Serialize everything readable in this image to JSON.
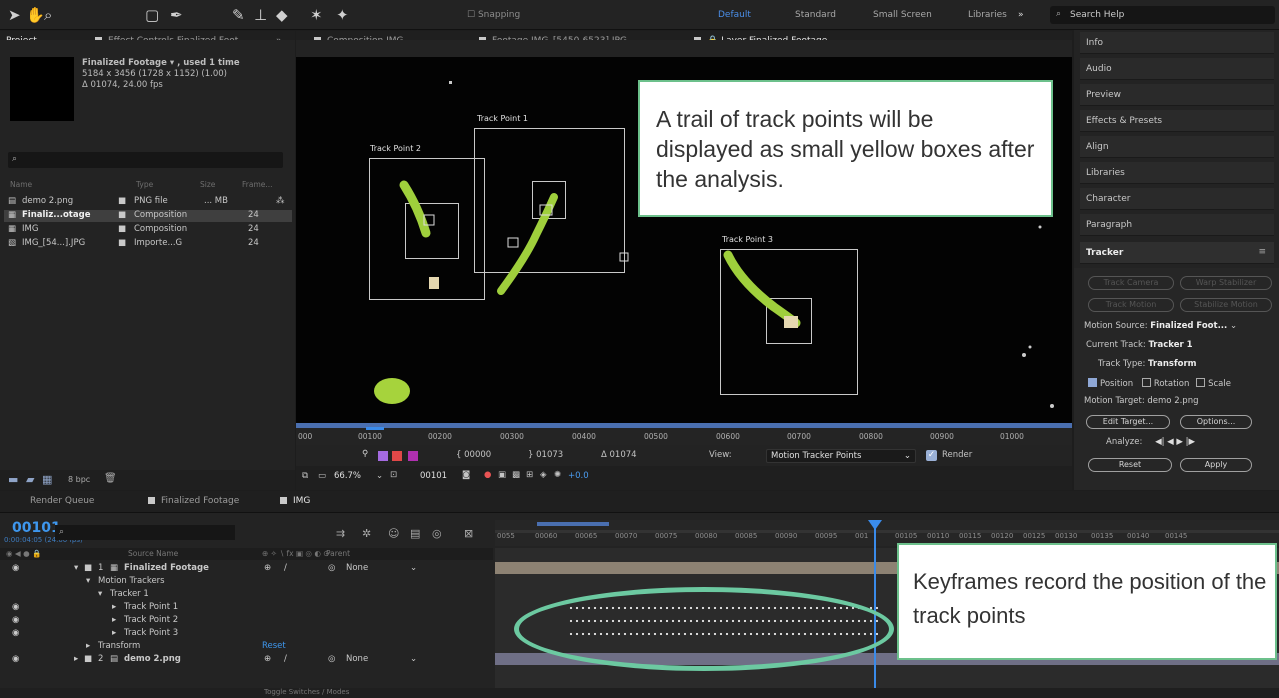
{
  "toolbar": {
    "snapping_label": "Snapping",
    "workspaces": [
      "Default",
      "Standard",
      "Small Screen",
      "Libraries"
    ],
    "overflow": "»",
    "search_placeholder": "Search Help"
  },
  "project_panel": {
    "tab_project": "Project",
    "tab_effect_controls": "Effect Controls Finalized Foot.",
    "overflow": "»",
    "info": {
      "name": "Finalized Footage ▾ , used 1 time",
      "dims": "5184 x 3456 (1728 x 1152) (1.00)",
      "duration": "Δ 01074, 24.00 fps"
    },
    "columns": [
      "Name",
      "Type",
      "Size",
      "Frame..."
    ],
    "rows": [
      {
        "name": "demo 2.png",
        "type": "PNG file",
        "size": "... MB",
        "rate": ""
      },
      {
        "name": "Finaliz...otage",
        "type": "Composition",
        "size": "",
        "rate": "24"
      },
      {
        "name": "IMG",
        "type": "Composition",
        "size": "",
        "rate": "24"
      },
      {
        "name": "IMG_[54...].JPG",
        "type": "Importe...G",
        "size": "",
        "rate": "24"
      }
    ],
    "bpc": "8 bpc"
  },
  "viewer": {
    "tabs": [
      "Composition IMG",
      "Footage IMG_[5450-6523].JPG",
      "Layer Finalized Footage"
    ],
    "track_points": [
      "Track Point 1",
      "Track Point 2",
      "Track Point 3"
    ],
    "ruler_labels": [
      "000",
      "00100",
      "00200",
      "00300",
      "00400",
      "00500",
      "00600",
      "00700",
      "00800",
      "00900",
      "01000"
    ],
    "in_point": "00000",
    "out_point": "01073",
    "duration": "Δ 01074",
    "view_label": "View:",
    "view_value": "Motion Tracker Points",
    "render_label": "Render",
    "zoom": "66.7%",
    "current_frame": "00101",
    "exposure": "+0.0",
    "callout": "A trail of track points will be displayed as small yellow boxes after the analysis."
  },
  "right_panel": {
    "items": [
      "Info",
      "Audio",
      "Preview",
      "Effects & Presets",
      "Align",
      "Libraries",
      "Character",
      "Paragraph"
    ],
    "tracker": {
      "title": "Tracker",
      "btn_track_camera": "Track Camera",
      "btn_warp": "Warp Stabilizer",
      "btn_track_motion": "Track Motion",
      "btn_stabilize": "Stabilize Motion",
      "motion_source_label": "Motion Source:",
      "motion_source": "Finalized Foot...",
      "current_track_label": "Current Track:",
      "current_track": "Tracker 1",
      "track_type_label": "Track Type:",
      "track_type": "Transform",
      "position": "Position",
      "rotation": "Rotation",
      "scale": "Scale",
      "motion_target": "Motion Target: demo 2.png",
      "edit_target": "Edit Target...",
      "options": "Options...",
      "analyze_label": "Analyze:",
      "analyze_controls": "◀| ◀ ▶ |▶",
      "reset": "Reset",
      "apply": "Apply"
    }
  },
  "timeline": {
    "tabs": [
      "Render Queue",
      "Finalized Footage",
      "IMG"
    ],
    "timecode": "00101",
    "timecode_sub": "0:00:04:05 (24.00 fps)",
    "columns": {
      "source": "Source Name",
      "parent": "Parent"
    },
    "layers": [
      {
        "indent": 0,
        "num": "1",
        "name": "Finalized Footage",
        "parent": "None"
      },
      {
        "indent": 1,
        "num": "",
        "name": "Motion Trackers",
        "parent": ""
      },
      {
        "indent": 2,
        "num": "",
        "name": "Tracker 1",
        "parent": ""
      },
      {
        "indent": 3,
        "num": "",
        "name": "Track Point 1",
        "parent": ""
      },
      {
        "indent": 3,
        "num": "",
        "name": "Track Point 2",
        "parent": ""
      },
      {
        "indent": 3,
        "num": "",
        "name": "Track Point 3",
        "parent": ""
      },
      {
        "indent": 1,
        "num": "",
        "name": "Transform",
        "parent": ""
      },
      {
        "indent": 0,
        "num": "2",
        "name": "demo 2.png",
        "parent": "None"
      }
    ],
    "reset_label": "Reset",
    "ruler_labels": [
      "0055",
      "00060",
      "00065",
      "00070",
      "00075",
      "00080",
      "00085",
      "00090",
      "00095",
      "001",
      "00105",
      "00110",
      "00115",
      "00120",
      "00125",
      "00130",
      "00135",
      "00140",
      "00145"
    ],
    "footer": "Toggle Switches / Modes",
    "callout": "Keyframes record the position of the track points"
  },
  "colors": {
    "accent_blue": "#3e97ee",
    "tracker_green": "#9fcf3c",
    "callout_border": "#6cc08b"
  }
}
